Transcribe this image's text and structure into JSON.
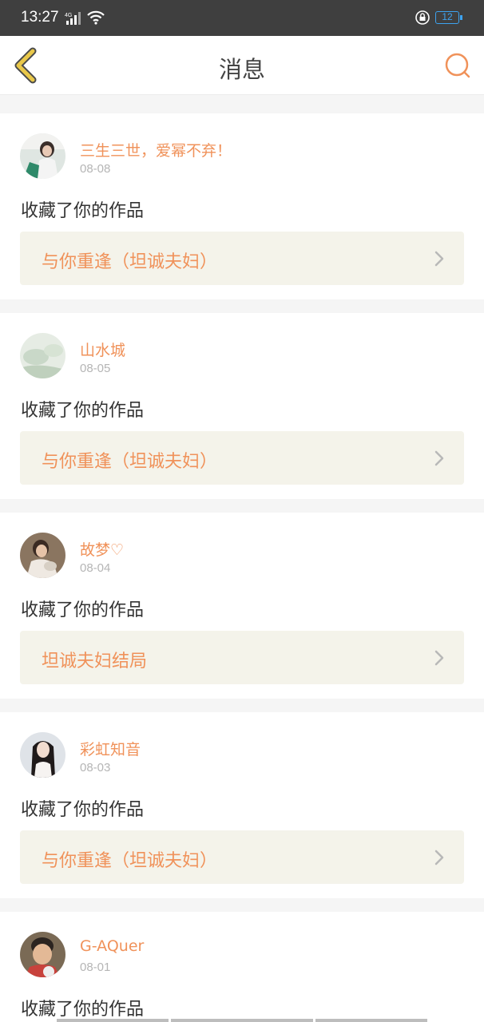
{
  "status_bar": {
    "time": "13:27",
    "network": "4G",
    "battery": "12",
    "icons": [
      "signal-icon",
      "wifi-icon",
      "lock-rotation-icon",
      "battery-icon"
    ]
  },
  "header": {
    "title": "消息",
    "back_icon": "chevron-left-icon",
    "search_icon": "search-icon",
    "accent_color": "#f0925a",
    "back_color": "#e9c84a"
  },
  "messages": [
    {
      "username": "三生三世，爱幂不弃！",
      "date": "08-08",
      "action": "收藏了你的作品",
      "work": "与你重逢（坦诚夫妇）"
    },
    {
      "username": "山水城",
      "date": "08-05",
      "action": "收藏了你的作品",
      "work": "与你重逢（坦诚夫妇）"
    },
    {
      "username": "故梦♡",
      "date": "08-04",
      "action": "收藏了你的作品",
      "work": "坦诚夫妇结局"
    },
    {
      "username": "彩虹知音",
      "date": "08-03",
      "action": "收藏了你的作品",
      "work": "与你重逢（坦诚夫妇）"
    },
    {
      "username": "G-AQuer",
      "date": "08-01",
      "action": "收藏了你的作品",
      "work": ""
    }
  ]
}
